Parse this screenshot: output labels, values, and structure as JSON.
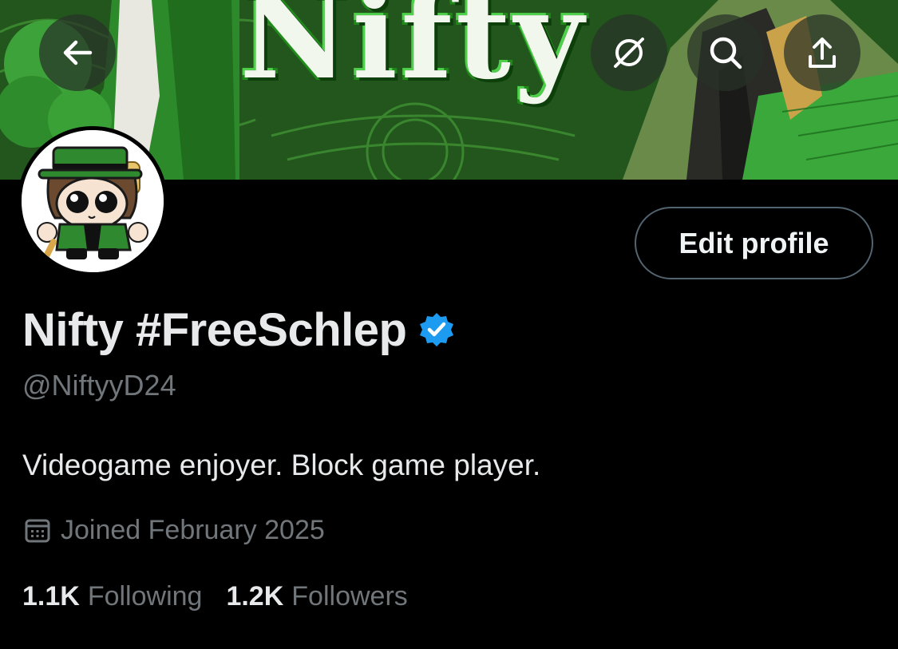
{
  "banner": {
    "title": "Nifty"
  },
  "nav": {
    "back_icon": "arrow-left-icon",
    "grok_icon": "slash-circle-icon",
    "search_icon": "search-icon",
    "share_icon": "share-upload-icon"
  },
  "profile": {
    "display_name": "Nifty #FreeSchlep",
    "verified_color": "#1d9bf0",
    "handle": "@NiftyyD24",
    "bio": "Videogame enjoyer. Block game player.",
    "joined": "Joined February 2025",
    "edit_button": "Edit profile",
    "following_count": "1.1K",
    "following_label": "Following",
    "followers_count": "1.2K",
    "followers_label": "Followers"
  }
}
